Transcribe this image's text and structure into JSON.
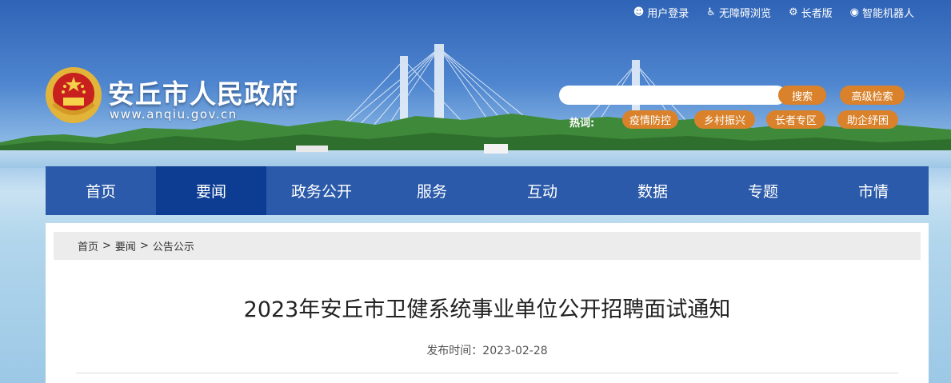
{
  "toplinks": [
    {
      "icon": "person-icon",
      "label": "用户登录"
    },
    {
      "icon": "wheelchair-icon",
      "label": "无障碍浏览"
    },
    {
      "icon": "elder-icon",
      "label": "长者版"
    },
    {
      "icon": "robot-icon",
      "label": "智能机器人"
    }
  ],
  "site": {
    "title": "安丘市人民政府",
    "url": "www.anqiu.gov.cn"
  },
  "search": {
    "placeholder": "",
    "button": "搜索",
    "advanced": "高级检索"
  },
  "hot": {
    "label": "热词:",
    "tags": [
      "疫情防控",
      "乡村振兴",
      "长者专区",
      "助企纾困"
    ]
  },
  "nav": {
    "items": [
      "首页",
      "要闻",
      "政务公开",
      "服务",
      "互动",
      "数据",
      "专题",
      "市情"
    ],
    "active": "要闻"
  },
  "breadcrumb": [
    "首页",
    "要闻",
    "公告公示"
  ],
  "breadcrumb_sep": ">",
  "article": {
    "title": "2023年安丘市卫健系统事业单位公开招聘面试通知",
    "date_label": "发布时间：2023-02-28"
  },
  "colors": {
    "nav_bg": "#2a5aa9",
    "nav_active": "#0c3d93",
    "accent": "#d9822b",
    "breadcrumb_bg": "#ececec"
  }
}
